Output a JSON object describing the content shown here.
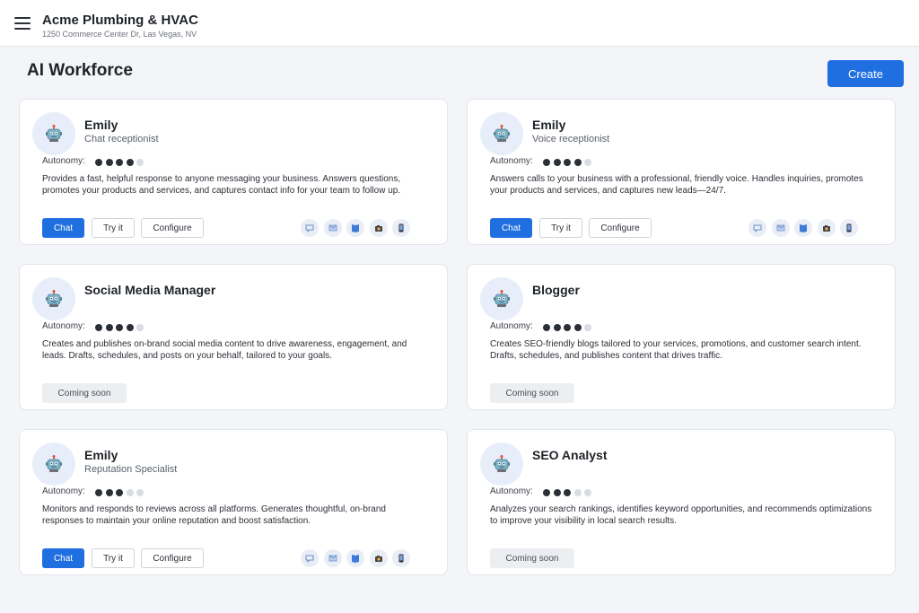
{
  "header": {
    "business_name": "Acme Plumbing & HVAC",
    "business_address": "1250 Commerce Center Dr, Las Vegas, NV"
  },
  "page": {
    "title": "AI Workforce",
    "create_label": "Create"
  },
  "labels": {
    "autonomy": "Autonomy:",
    "chat": "Chat",
    "try_it": "Try it",
    "configure": "Configure",
    "coming_soon": "Coming soon"
  },
  "channel_icons": [
    "chat-bubble-icon",
    "email-icon",
    "book-icon",
    "camera-icon",
    "phone-icon"
  ],
  "colors": {
    "primary": "#1f6fe0",
    "page_bg": "#f4f5f8",
    "dot_on": "#2b2f36",
    "dot_off": "#d9dce1"
  },
  "agents": [
    {
      "name": "Emily",
      "role": "Chat receptionist",
      "autonomy": 4,
      "autonomy_max": 5,
      "description": "Provides a fast, helpful response to anyone messaging your business. Answers questions, promotes your products and services, and captures contact info for your team to follow up.",
      "status": "active"
    },
    {
      "name": "Emily",
      "role": "Voice receptionist",
      "autonomy": 4,
      "autonomy_max": 5,
      "description": "Answers calls to your business with a professional, friendly voice. Handles inquiries, promotes your products and services, and captures new leads—24/7.",
      "status": "active"
    },
    {
      "name": "Social Media Manager",
      "role": "",
      "autonomy": 4,
      "autonomy_max": 5,
      "description": "Creates and publishes on-brand social media content to drive awareness, engagement, and leads. Drafts, schedules, and posts on your behalf, tailored to your goals.",
      "status": "coming_soon"
    },
    {
      "name": "Blogger",
      "role": "",
      "autonomy": 4,
      "autonomy_max": 5,
      "description": "Creates SEO-friendly blogs tailored to your services, promotions, and customer search intent. Drafts, schedules, and publishes content that drives traffic.",
      "status": "coming_soon"
    },
    {
      "name": "Emily",
      "role": "Reputation Specialist",
      "autonomy": 3,
      "autonomy_max": 5,
      "description": "Monitors and responds to reviews across all platforms. Generates thoughtful, on-brand responses to maintain your online reputation and boost satisfaction.",
      "status": "active"
    },
    {
      "name": "SEO Analyst",
      "role": "",
      "autonomy": 3,
      "autonomy_max": 5,
      "description": "Analyzes your search rankings, identifies keyword opportunities, and recommends optimizations to improve your visibility in local search results.",
      "status": "coming_soon"
    }
  ]
}
